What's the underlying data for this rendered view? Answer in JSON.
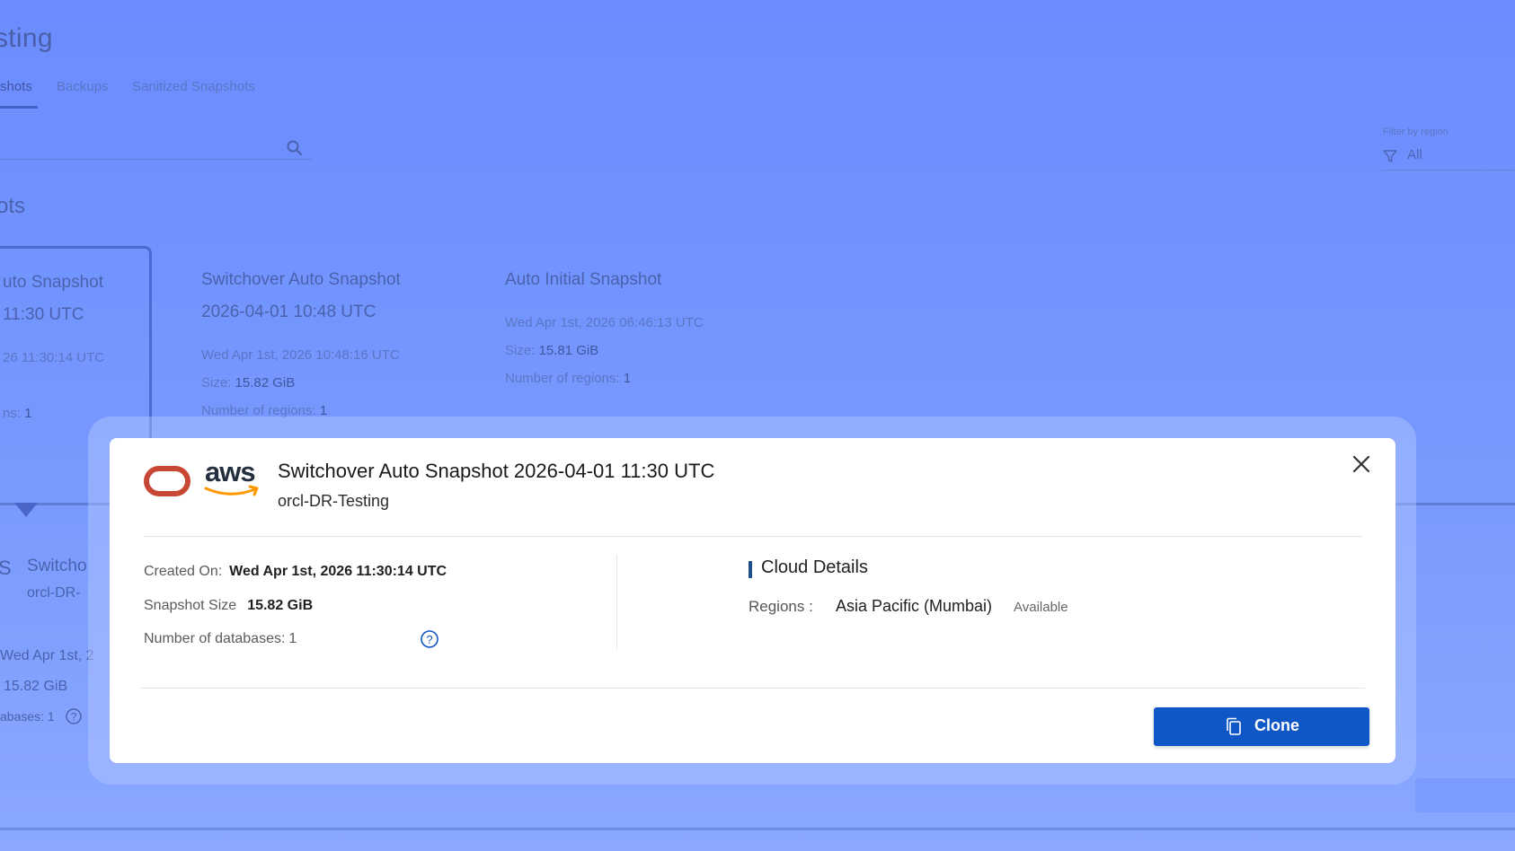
{
  "background": {
    "page_title": "sting",
    "tabs": [
      {
        "label": "shots",
        "active": true
      },
      {
        "label": "Backups",
        "active": false
      },
      {
        "label": "Sanitized Snapshots",
        "active": false
      }
    ],
    "filter_label": "Filter by region",
    "filter_value": "All",
    "section_title": "ots",
    "cards": [
      {
        "title_line1": "uto Snapshot",
        "title_line2": " 11:30 UTC",
        "date": "26 11:30:14 UTC",
        "size_label": "",
        "size": "",
        "regions_label": "ns:",
        "regions": "1"
      },
      {
        "title_line1": "Switchover Auto Snapshot",
        "title_line2": "2026-04-01 10:48 UTC",
        "date": "Wed Apr 1st, 2026 10:48:16 UTC",
        "size_label": "Size:",
        "size": "15.82 GiB",
        "regions_label": "Number of regions:",
        "regions": "1"
      },
      {
        "title_line1": "Auto Initial Snapshot",
        "title_line2": "",
        "date": "Wed Apr 1st, 2026 06:46:13 UTC",
        "size_label": "Size:",
        "size": "15.81 GiB",
        "regions_label": "Number of regions:",
        "regions": "1"
      }
    ],
    "detail": {
      "logo_fragment": "S",
      "title_fragment": "Switcho",
      "subtitle_fragment": "orcl-DR-",
      "date_fragment": "Wed Apr 1st, 2",
      "size_fragment": "15.82 GiB",
      "databases_fragment": "abases: 1"
    }
  },
  "modal": {
    "logos": {
      "oracle": "oracle-logo-icon",
      "aws_text": "aws"
    },
    "title": "Switchover Auto Snapshot 2026-04-01 11:30 UTC",
    "subtitle": "orcl-DR-Testing",
    "created_on_label": "Created On:",
    "created_on_value": "Wed Apr 1st, 2026 11:30:14 UTC",
    "snapshot_size_label": "Snapshot Size",
    "snapshot_size_value": "15.82 GiB",
    "num_databases_label": "Number of databases:",
    "num_databases_value": "1",
    "cloud_details_title": "Cloud Details",
    "regions_label": "Regions :",
    "region_value": "Asia Pacific (Mumbai)",
    "region_status": "Available",
    "clone_label": "Clone",
    "colors": {
      "primary": "#0f56c6",
      "oracle_red": "#c74634",
      "aws_orange": "#ff9900",
      "aws_dark": "#232f3e"
    }
  }
}
